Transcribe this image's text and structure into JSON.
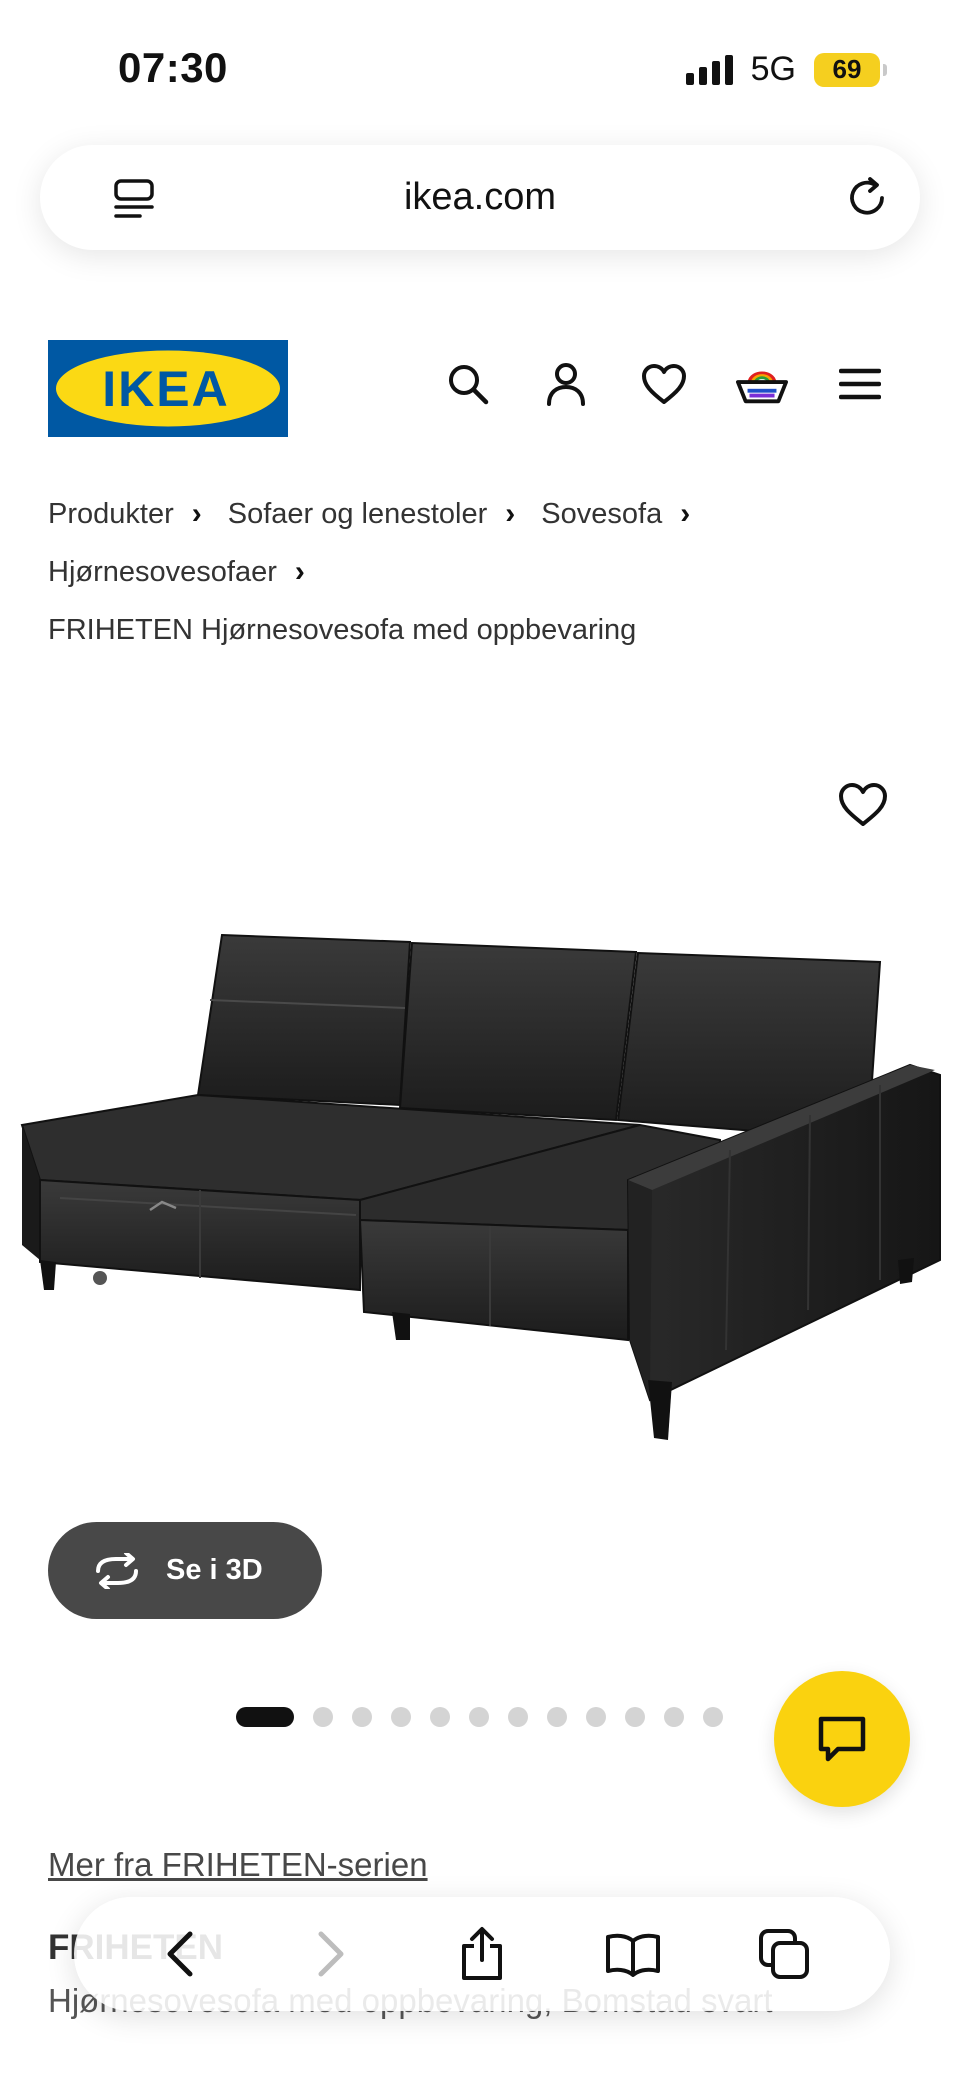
{
  "status_bar": {
    "time": "07:30",
    "network": "5G",
    "battery": "69"
  },
  "browser": {
    "url": "ikea.com"
  },
  "header": {
    "logo_text": "IKEA",
    "icons": [
      "search-icon",
      "user-icon",
      "heart-icon",
      "cart-icon",
      "menu-icon"
    ]
  },
  "breadcrumb": {
    "items": [
      "Produkter",
      "Sofaer og lenestoler",
      "Sovesofa",
      "Hjørnesovesofaer"
    ],
    "current": "FRIHETEN Hjørnesovesofa med oppbevaring"
  },
  "gallery": {
    "view_3d_label": "Se i 3D",
    "slide_count": 12,
    "active_slide": 1
  },
  "product": {
    "series_link": "Mer fra FRIHETEN-serien",
    "name": "FRIHETEN",
    "description": "Hjørnesovesofa med oppbevaring, Bomstad svart"
  },
  "colors": {
    "ikea_blue": "#0058a3",
    "ikea_yellow": "#fbd914",
    "chat_yellow": "#fad20f",
    "button_dark": "#484848"
  }
}
